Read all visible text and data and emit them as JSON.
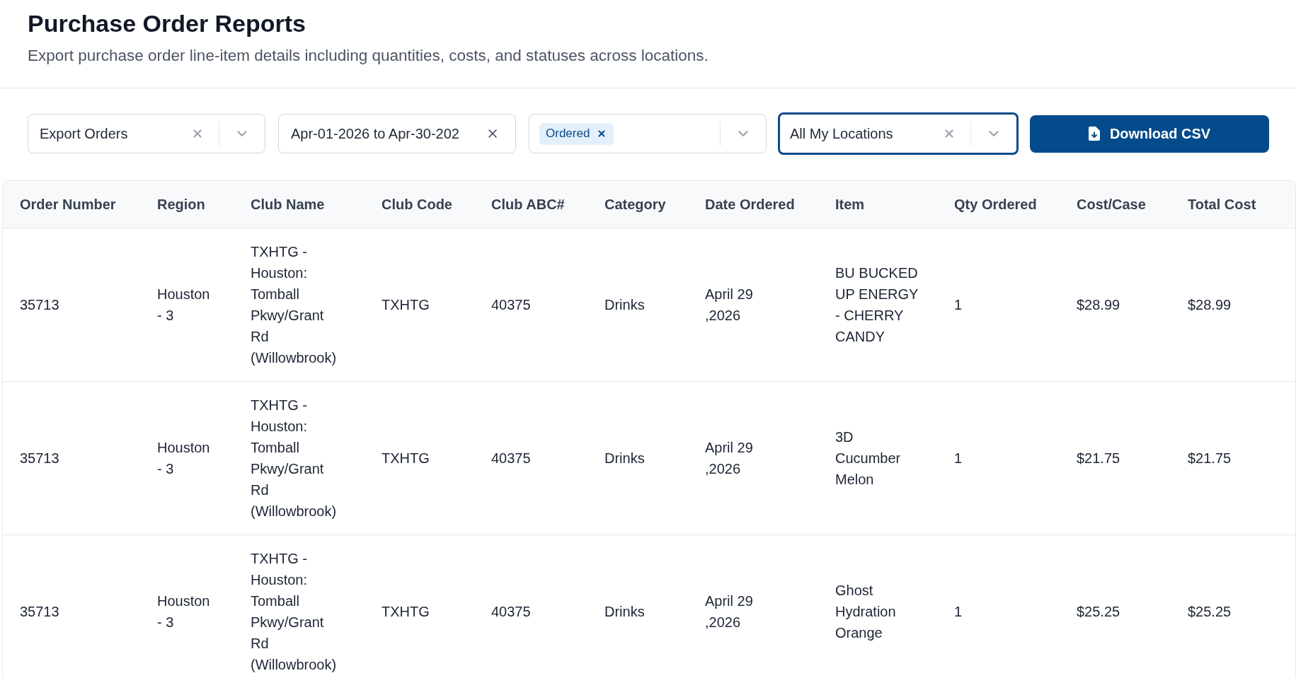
{
  "page": {
    "title": "Purchase Order Reports",
    "subtitle": "Export purchase order line-item details including quantities, costs, and statuses across locations."
  },
  "filters": [
    {
      "kind": "select",
      "value": "Export Orders",
      "focused": false
    },
    {
      "kind": "date_range",
      "value": "Apr-01-2026 to Apr-30-202",
      "focused": false
    },
    {
      "kind": "multi_select",
      "chips": [
        "Ordered"
      ],
      "focused": false
    },
    {
      "kind": "select",
      "value": "All My Locations",
      "focused": true
    }
  ],
  "download_button": {
    "label": "Download CSV"
  },
  "table": {
    "columns": [
      "Order Number",
      "Region",
      "Club Name",
      "Club Code",
      "Club ABC#",
      "Category",
      "Date Ordered",
      "Item",
      "Qty Ordered",
      "Cost/Case",
      "Total Cost"
    ],
    "rows": [
      {
        "cells": [
          "35713",
          "Houston - 3",
          "TXHTG - Houston: Tomball Pkwy/Grant Rd (Willowbrook)",
          "TXHTG",
          "40375",
          "Drinks",
          "April 29 ,2026",
          "BU BUCKED UP ENERGY - CHERRY CANDY",
          "1",
          "$28.99",
          "$28.99"
        ]
      },
      {
        "cells": [
          "35713",
          "Houston - 3",
          "TXHTG - Houston: Tomball Pkwy/Grant Rd (Willowbrook)",
          "TXHTG",
          "40375",
          "Drinks",
          "April 29 ,2026",
          "3D Cucumber Melon",
          "1",
          "$21.75",
          "$21.75"
        ]
      },
      {
        "cells": [
          "35713",
          "Houston - 3",
          "TXHTG - Houston: Tomball Pkwy/Grant Rd (Willowbrook)",
          "TXHTG",
          "40375",
          "Drinks",
          "April 29 ,2026",
          "Ghost Hydration Orange",
          "1",
          "$25.25",
          "$25.25"
        ]
      }
    ]
  }
}
